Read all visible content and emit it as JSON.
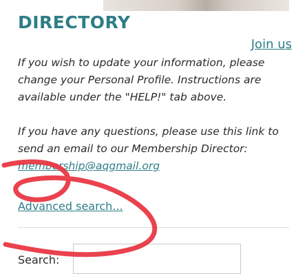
{
  "header": {
    "title": "DIRECTORY",
    "join_link": "Join us"
  },
  "info": {
    "paragraph1": "If you wish to update your information, please change your Personal Profile.  Instructions are available under the \"HELP!\" tab above.",
    "paragraph2_prefix": "If you have any questions, please use this link to send an email to our Membership Director:  ",
    "email": "membership@aqgmail.org"
  },
  "search": {
    "advanced_link": "Advanced search...",
    "label": "Search:",
    "value": ""
  },
  "colors": {
    "accent": "#2e7d87",
    "scribble": "#e8323f"
  }
}
